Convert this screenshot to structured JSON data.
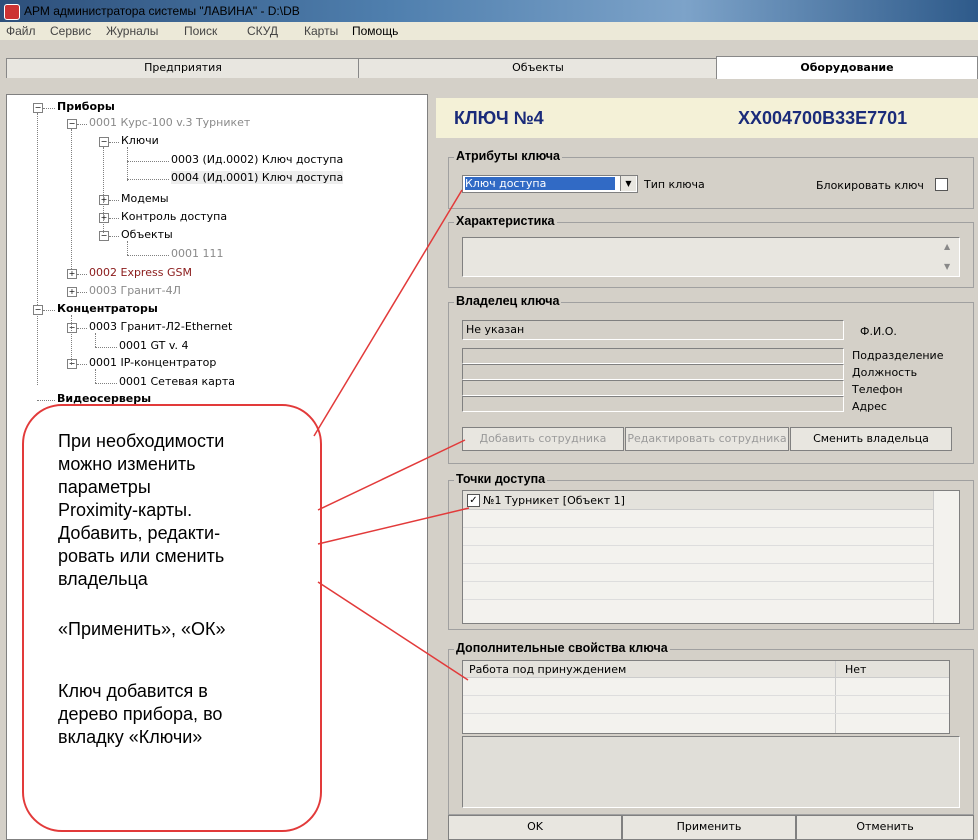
{
  "window": {
    "title": "АРМ администратора системы \"ЛАВИНА\" - D:\\DB"
  },
  "menu": {
    "items": [
      "Файл",
      "Сервис",
      "Журналы",
      "Поиск",
      "СКУД",
      "Карты",
      "Помощь"
    ]
  },
  "tabs": [
    {
      "label": "Предприятия"
    },
    {
      "label": "Объекты"
    },
    {
      "label": "Оборудование"
    }
  ],
  "tree": {
    "devices": "Приборы",
    "device1": "0001  Курс-100 v.3 Турникет",
    "keys": "Ключи",
    "key1": "0003 (Ид.0002)  Ключ доступа",
    "key2": "0004 (Ид.0001)  Ключ доступа",
    "modems": "Модемы",
    "access_control": "Контроль доступа",
    "objects": "Объекты",
    "object1": "0001  111",
    "device2": "0002  Express GSM",
    "device3": "0003  Гранит-4Л",
    "concentrators": "Концентраторы",
    "conc1": "0003  Гранит-Л2-Ethernet",
    "conc1_child": "0001  GT  v. 4",
    "conc2": "0001  IP-концентратор",
    "conc2_child": "0001  Сетевая карта",
    "videoservers": "Видеосерверы"
  },
  "key": {
    "title": "КЛЮЧ №4",
    "code": "XX004700B33E7701"
  },
  "attributes": {
    "group_title": "Атрибуты ключа",
    "type_value": "Ключ доступа",
    "type_label": "Тип ключа",
    "block_label": "Блокировать ключ",
    "block_checked": false
  },
  "characteristic": {
    "group_title": "Характеристика",
    "value": ""
  },
  "owner": {
    "group_title": "Владелец ключа",
    "name_value": "Не указан",
    "labels": [
      "Ф.И.О.",
      "Подразделение",
      "Должность",
      "Телефон",
      "Адрес"
    ],
    "add_button": "Добавить сотрудника",
    "edit_button": "Редактировать сотрудника",
    "change_button": "Сменить владельца"
  },
  "access_points": {
    "group_title": "Точки доступа",
    "items": [
      {
        "label": "№1 Турникет  [Объект 1]",
        "checked": true
      }
    ]
  },
  "extra": {
    "group_title": "Дополнительные свойства ключа",
    "rows": [
      {
        "name": "Работа под принуждением",
        "value": "Нет"
      }
    ]
  },
  "footer": {
    "ok": "OK",
    "apply": "Применить",
    "cancel": "Отменить"
  },
  "callout": {
    "lines": [
      "При необходимости",
      "можно изменить",
      "параметры",
      "Proximity-карты.",
      "Добавить,  редакти-",
      "ровать или сменить",
      "владельца",
      "",
      "«Применить», «ОК»",
      "",
      "Ключ добавится в",
      "дерево прибора, во",
      "вкладку «Ключи»"
    ]
  },
  "colors": {
    "accent_title": "#1a2b7a",
    "callout_border": "#e23a3a",
    "header_bg": "#f4f1d7"
  }
}
